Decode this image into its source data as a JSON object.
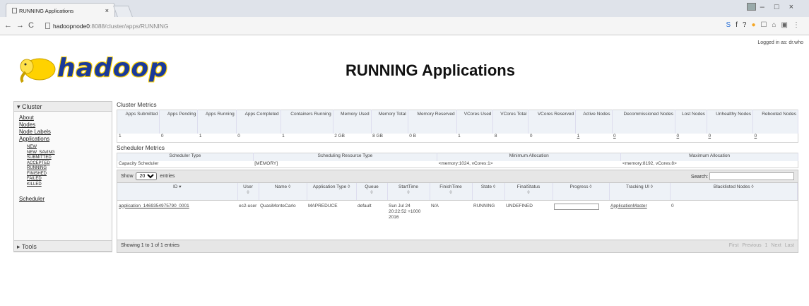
{
  "browser": {
    "tab_title": "RUNNING Applications",
    "tab_close": "×",
    "url_host": "hadoopnode0",
    "url_rest": ":8088/cluster/apps/RUNNING",
    "nav_back": "←",
    "nav_forward": "→",
    "nav_reload": "C",
    "ext_icons": [
      "S",
      "f?",
      "●",
      "☐",
      "⌂",
      "▣",
      "⋮"
    ],
    "win_min": "–",
    "win_max": "□",
    "win_close": "×"
  },
  "header": {
    "logo_text": "hadoop",
    "page_title": "RUNNING Applications",
    "logged_in": "Logged in as: dr.who"
  },
  "sidebar": {
    "cluster_label": "▾ Cluster",
    "links": [
      "About",
      "Nodes",
      "Node Labels",
      "Applications"
    ],
    "app_states": [
      "NEW",
      "NEW_SAVING",
      "SUBMITTED",
      "ACCEPTED",
      "RUNNING",
      "FINISHED",
      "FAILED",
      "KILLED"
    ],
    "scheduler": "Scheduler",
    "tools_label": "▸ Tools"
  },
  "cluster_metrics": {
    "title": "Cluster Metrics",
    "headers": [
      "Apps Submitted",
      "Apps Pending",
      "Apps Running",
      "Apps Completed",
      "Containers Running",
      "Memory Used",
      "Memory Total",
      "Memory Reserved",
      "VCores Used",
      "VCores Total",
      "VCores Reserved",
      "Active Nodes",
      "Decommissioned Nodes",
      "Lost Nodes",
      "Unhealthy Nodes",
      "Rebooted Nodes"
    ],
    "values": [
      "1",
      "0",
      "1",
      "0",
      "1",
      "2 GB",
      "8 GB",
      "0 B",
      "1",
      "8",
      "0",
      "1",
      "0",
      "0",
      "0",
      "0"
    ]
  },
  "scheduler_metrics": {
    "title": "Scheduler Metrics",
    "headers": [
      "Scheduler Type",
      "Scheduling Resource Type",
      "Minimum Allocation",
      "Maximum Allocation"
    ],
    "values": [
      "Capacity Scheduler",
      "[MEMORY]",
      "<memory:1024, vCores:1>",
      "<memory:8192, vCores:8>"
    ]
  },
  "table_controls": {
    "show_prefix": "Show",
    "entries_value": "20",
    "entries_suffix": "entries",
    "search_label": "Search:"
  },
  "apps_table": {
    "headers": [
      "ID",
      "User",
      "Name",
      "Application Type",
      "Queue",
      "StartTime",
      "FinishTime",
      "State",
      "FinalStatus",
      "Progress",
      "Tracking UI",
      "Blacklisted Nodes"
    ],
    "sort_marks": [
      "▾",
      "◊",
      "◊",
      "◊",
      "◊",
      "◊",
      "◊",
      "◊",
      "◊",
      "◊",
      "◊",
      "◊"
    ],
    "row": {
      "id": "application_1469354975790_0001",
      "user": "ec2-user",
      "name": "QuasiMonteCarlo",
      "type": "MAPREDUCE",
      "queue": "default",
      "start": "Sun Jul 24 20:22:52 +1000 2016",
      "finish": "N/A",
      "state": "RUNNING",
      "final_status": "UNDEFINED",
      "tracking": "ApplicationMaster",
      "blacklisted": "0"
    }
  },
  "footer": {
    "showing": "Showing 1 to 1 of 1 entries",
    "pager": [
      "First",
      "Previous",
      "1",
      "Next",
      "Last"
    ]
  }
}
